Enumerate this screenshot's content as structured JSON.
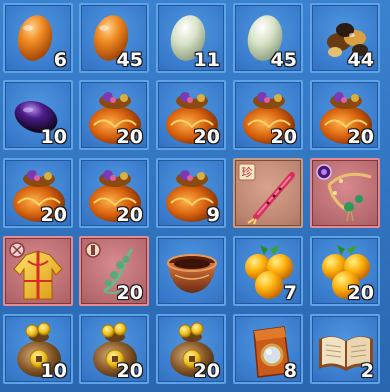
{
  "inventory": {
    "slots": [
      {
        "item": "orange-egg-icon",
        "count": "6"
      },
      {
        "item": "orange-egg-icon",
        "count": "45"
      },
      {
        "item": "pale-egg-icon",
        "count": "11"
      },
      {
        "item": "pale-egg-icon",
        "count": "45"
      },
      {
        "item": "assorted-stones-icon",
        "count": "44"
      },
      {
        "item": "purple-egg-icon",
        "count": "10"
      },
      {
        "item": "treasure-pouch-icon",
        "count": "20"
      },
      {
        "item": "treasure-pouch-icon",
        "count": "20"
      },
      {
        "item": "treasure-pouch-icon",
        "count": "20"
      },
      {
        "item": "treasure-pouch-icon",
        "count": "20"
      },
      {
        "item": "treasure-pouch-icon",
        "count": "20"
      },
      {
        "item": "treasure-pouch-icon",
        "count": "20"
      },
      {
        "item": "treasure-pouch-icon",
        "count": "9"
      },
      {
        "item": "red-flute-icon",
        "count": "",
        "badge": "珍"
      },
      {
        "item": "jade-necklace-icon",
        "count": ""
      },
      {
        "item": "golden-robe-icon",
        "count": ""
      },
      {
        "item": "jade-pendant-icon",
        "count": "20"
      },
      {
        "item": "clay-bowl-icon",
        "count": ""
      },
      {
        "item": "orange-fruit-icon",
        "count": "7"
      },
      {
        "item": "orange-fruit-icon",
        "count": "20"
      },
      {
        "item": "coin-bag-icon",
        "count": "10"
      },
      {
        "item": "coin-bag-icon",
        "count": "20"
      },
      {
        "item": "coin-bag-icon",
        "count": "20"
      },
      {
        "item": "mirror-pouch-icon",
        "count": "8"
      },
      {
        "item": "open-book-icon",
        "count": "2"
      }
    ]
  },
  "colors": {
    "background": "#2c6fbb",
    "slot": "#3a7ccd",
    "slot_border": "#5ea2e8",
    "rare_slot": "#b66a6e",
    "count_text": "#ffffff"
  }
}
